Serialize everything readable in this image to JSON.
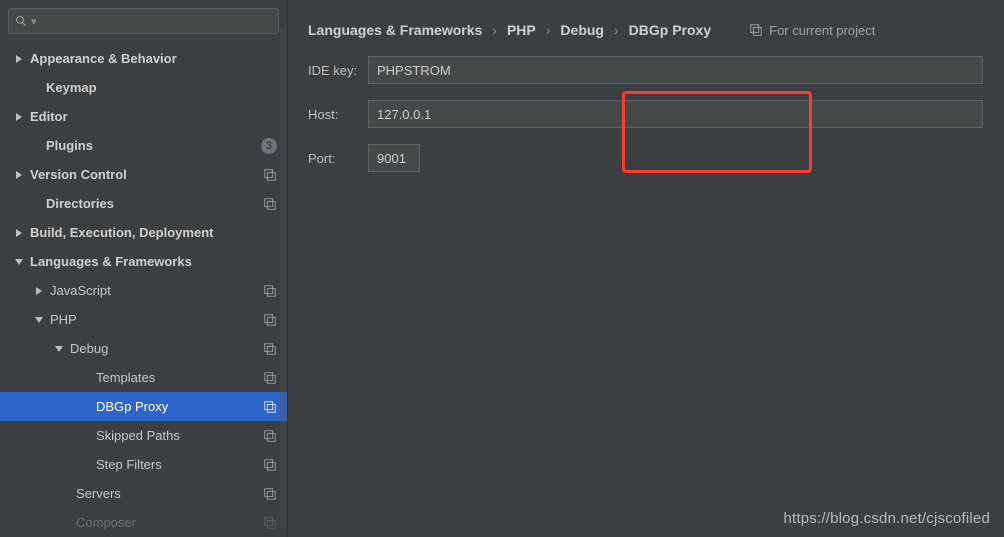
{
  "sidebar": {
    "search_ph": "",
    "items": [
      {
        "label": "Appearance & Behavior",
        "indent": 14,
        "arrow": "right",
        "bold": true
      },
      {
        "label": "Keymap",
        "indent": 30,
        "arrow": "",
        "bold": true
      },
      {
        "label": "Editor",
        "indent": 14,
        "arrow": "right",
        "bold": true
      },
      {
        "label": "Plugins",
        "indent": 30,
        "arrow": "",
        "bold": true,
        "count": "3"
      },
      {
        "label": "Version Control",
        "indent": 14,
        "arrow": "right",
        "bold": true,
        "proj": true
      },
      {
        "label": "Directories",
        "indent": 30,
        "arrow": "",
        "bold": true,
        "proj": true
      },
      {
        "label": "Build, Execution, Deployment",
        "indent": 14,
        "arrow": "right",
        "bold": true
      },
      {
        "label": "Languages & Frameworks",
        "indent": 14,
        "arrow": "down",
        "bold": true
      },
      {
        "label": "JavaScript",
        "indent": 34,
        "arrow": "right",
        "bold": false,
        "proj": true
      },
      {
        "label": "PHP",
        "indent": 34,
        "arrow": "down",
        "bold": false,
        "proj": true
      },
      {
        "label": "Debug",
        "indent": 54,
        "arrow": "down",
        "bold": false,
        "proj": true
      },
      {
        "label": "Templates",
        "indent": 80,
        "arrow": "",
        "bold": false,
        "proj": true
      },
      {
        "label": "DBGp Proxy",
        "indent": 80,
        "arrow": "",
        "bold": false,
        "proj": true,
        "selected": true
      },
      {
        "label": "Skipped Paths",
        "indent": 80,
        "arrow": "",
        "bold": false,
        "proj": true
      },
      {
        "label": "Step Filters",
        "indent": 80,
        "arrow": "",
        "bold": false,
        "proj": true
      },
      {
        "label": "Servers",
        "indent": 60,
        "arrow": "",
        "bold": false,
        "proj": true
      },
      {
        "label": "Composer",
        "indent": 60,
        "arrow": "",
        "bold": false,
        "proj": true,
        "dim": true
      }
    ]
  },
  "breadcrumb": [
    "Languages & Frameworks",
    "PHP",
    "Debug",
    "DBGp Proxy"
  ],
  "scope_label": "For current project",
  "form": {
    "ide_key_label": "IDE key:",
    "ide_key_value": "PHPSTROM",
    "host_label": "Host:",
    "host_value": "127.0.0.1",
    "port_label": "Port:",
    "port_value": "9001"
  },
  "watermark": "https://blog.csdn.net/cjscofiled"
}
